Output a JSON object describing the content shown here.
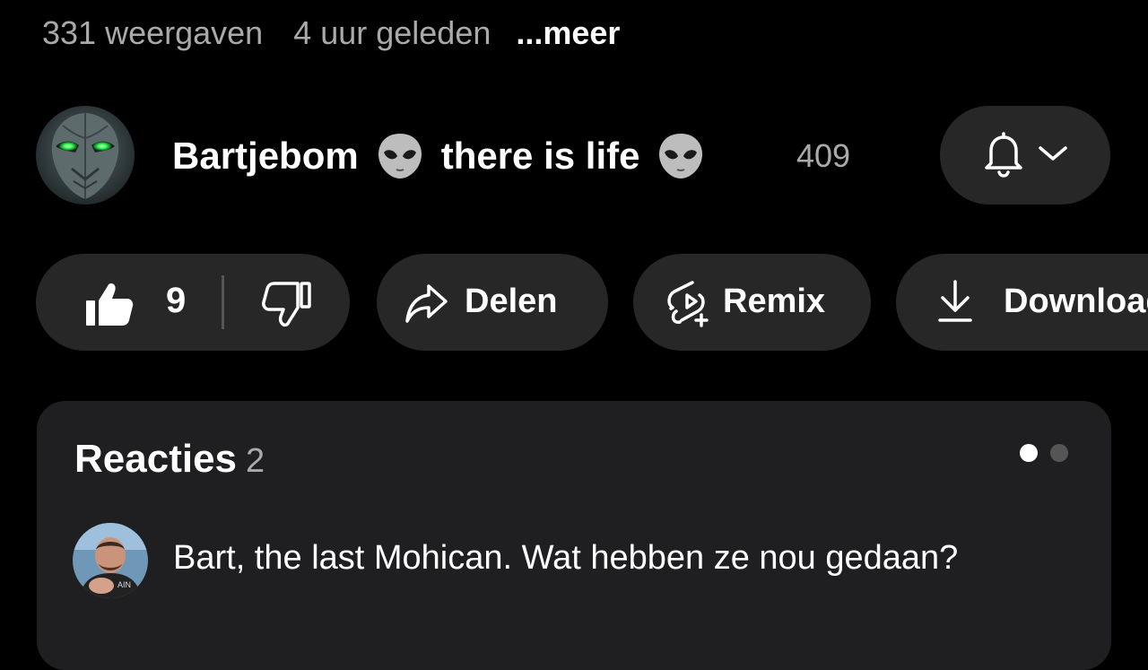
{
  "video_meta": {
    "views": "331 weergaven",
    "age": "4 uur geleden",
    "more_label": "...meer"
  },
  "channel": {
    "name_part1": "Bartjebom",
    "name_part2": "there is life",
    "emoji": "alien-emoji",
    "subscriber_count": "409",
    "avatar": "alien-head-avatar",
    "notification_icon": "bell-icon",
    "dropdown_icon": "chevron-down-icon"
  },
  "actions": {
    "like_count": "9",
    "like_icon": "thumbs-up-icon",
    "dislike_icon": "thumbs-down-icon",
    "share_label": "Delen",
    "share_icon": "share-arrow-icon",
    "remix_label": "Remix",
    "remix_icon": "remix-icon",
    "download_label": "Download",
    "download_icon": "download-icon"
  },
  "comments": {
    "title": "Reacties",
    "count": "2",
    "top_comment": {
      "avatar": "user-avatar",
      "text": "Bart, the last Mohican. Wat hebben ze nou gedaan?"
    }
  },
  "colors": {
    "background": "#000000",
    "pill": "#272727",
    "card": "#1f1f21",
    "secondary_text": "#aaaaaa",
    "alien_eyes": "#3cff5a"
  }
}
